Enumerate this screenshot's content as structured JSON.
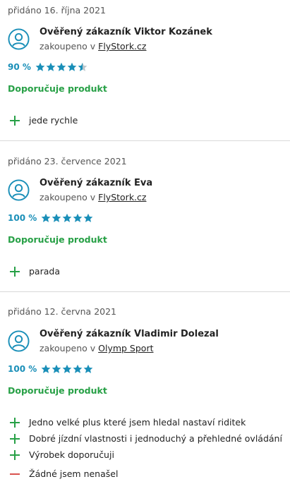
{
  "colors": {
    "accent_blue": "#1a8fb8",
    "recommend_green": "#27a046",
    "pro_green": "#27a046",
    "con_red": "#d9534f",
    "star_empty": "#b9c6cc"
  },
  "reviews": [
    {
      "date": "přidáno 16. října 2021",
      "customer": "Ověřený zákazník Viktor Kozánek",
      "bought_prefix": "zakoupeno v",
      "shop": "FlyStork.cz",
      "percent": "90 %",
      "rating": 4.5,
      "recommend": "Doporučuje produkt",
      "pros": [
        "jede rychle"
      ],
      "cons": []
    },
    {
      "date": "přidáno 23. července 2021",
      "customer": "Ověřený zákazník Eva",
      "bought_prefix": "zakoupeno v",
      "shop": "FlyStork.cz",
      "percent": "100 %",
      "rating": 5,
      "recommend": "Doporučuje produkt",
      "pros": [
        "parada"
      ],
      "cons": []
    },
    {
      "date": "přidáno 12. června 2021",
      "customer": "Ověřený zákazník Vladimir Dolezal",
      "bought_prefix": "zakoupeno v",
      "shop": "Olymp Sport",
      "percent": "100 %",
      "rating": 5,
      "recommend": "Doporučuje produkt",
      "pros": [
        "Jedno velké plus které jsem hledal nastaví riditek",
        "Dobré jízdní vlastnosti i jednoduchý a přehledné ovládání",
        "Výrobek doporučuji"
      ],
      "cons": [
        "Žádné jsem nenašel"
      ]
    }
  ]
}
